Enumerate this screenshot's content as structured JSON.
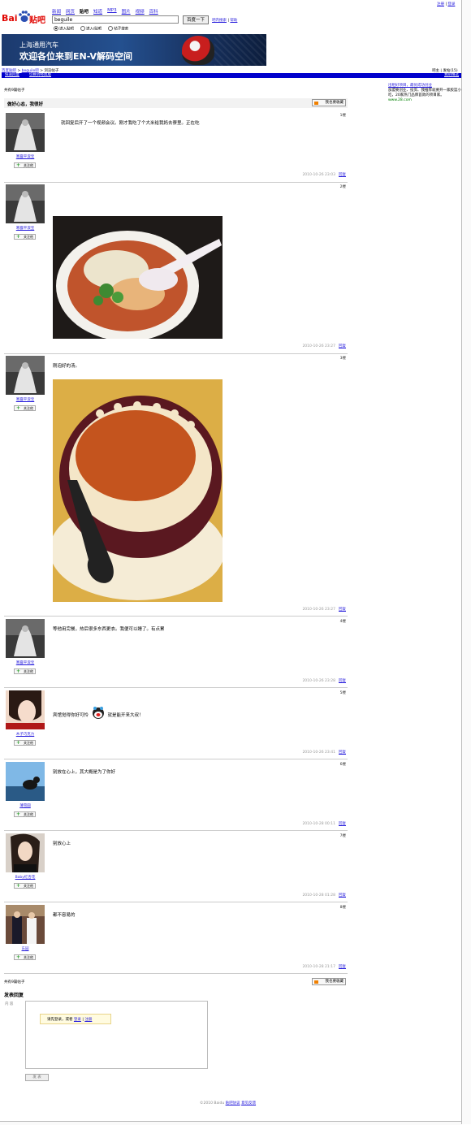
{
  "header": {
    "nav": [
      "新闻",
      "网页",
      "贴吧",
      "知道",
      "MP3",
      "图片",
      "视频",
      "百科"
    ],
    "nav_current": "贴吧",
    "search_value": "beguile",
    "search_button": "百度一下",
    "link_search_results": "吧内搜索",
    "link_help": "帮助",
    "radios": [
      "进入贴吧",
      "进入i贴吧",
      "帖子搜索"
    ],
    "top_right_register": "注册",
    "top_right_login": "登录"
  },
  "banner": {
    "line1": "上海通用汽车",
    "line2": "欢迎各位来到EN-V解码空间"
  },
  "breadcrumb": {
    "home": "百度贴吧",
    "bar": "beguile吧",
    "current": "浏览帖子",
    "right_links": "吧主 | 发帖(15)",
    "bar_left1": "快速回复",
    "bar_left2": "切换到经典版",
    "bar_right": "我吧精选"
  },
  "thread": {
    "count_top": "共有9篇帖子",
    "count_bottom": "共有9篇帖子",
    "title": "做好心态，我很好",
    "fav_button": "我也要收藏"
  },
  "ad": {
    "title": "出租好项目，最优成功创业",
    "body": "加盟要创业、投资、我推荐就要开一家胶篮小吃，20家热门品牌首款的项目家。",
    "url": "www.28.com"
  },
  "posts": [
    {
      "user": "寒露平淑宝",
      "floor": "1楼",
      "text": "就回复后开了一个视频会议。刚才我吃了个大米给我妈去寮里。正在吃",
      "time": "2010-10-26 23:03",
      "reply": "回复"
    },
    {
      "user": "寒露平淑宝",
      "floor": "2楼",
      "text": "",
      "time": "2010-10-26 23:27",
      "reply": "回复"
    },
    {
      "user": "寒露平淑宝",
      "floor": "3楼",
      "text": "刚泡好的汤。",
      "time": "2010-10-26 23:27",
      "reply": "回复"
    },
    {
      "user": "寒露平淑宝",
      "floor": "4楼",
      "text": "等他用完餐，热后很多东西更衣。我便可以睡了。有点累",
      "time": "2010-10-26 23:28",
      "reply": "回复"
    },
    {
      "user": "木子巧克力",
      "floor": "5楼",
      "text": "宾馆觉得你好可怜",
      "text2": "就是能开来大叔！",
      "time": "2010-10-26 23:41",
      "reply": "回复"
    },
    {
      "user": "薄雪圆",
      "floor": "6楼",
      "text": "别放在心上，其大概是为了你好",
      "time": "2010-10-28 00:11",
      "reply": "回复"
    },
    {
      "user": "Baby红杏花",
      "floor": "7楼",
      "text": "别放心上",
      "time": "2010-10-28 01:28",
      "reply": "回复"
    },
    {
      "user": "东园",
      "floor": "8楼",
      "text": "都不容易的",
      "time": "2010-10-28 21:17",
      "reply": "回复"
    }
  ],
  "follow_label": "关注他",
  "reply": {
    "title": "发表回复",
    "content_label": "内 容",
    "tip_text": "请先登录，或者",
    "tip_login": "登录",
    "tip_register": "注册",
    "submit": "发 表"
  },
  "footer": {
    "text": "©2010 Baidu",
    "link1": "贴吧协议",
    "link2": "意见反馈"
  }
}
